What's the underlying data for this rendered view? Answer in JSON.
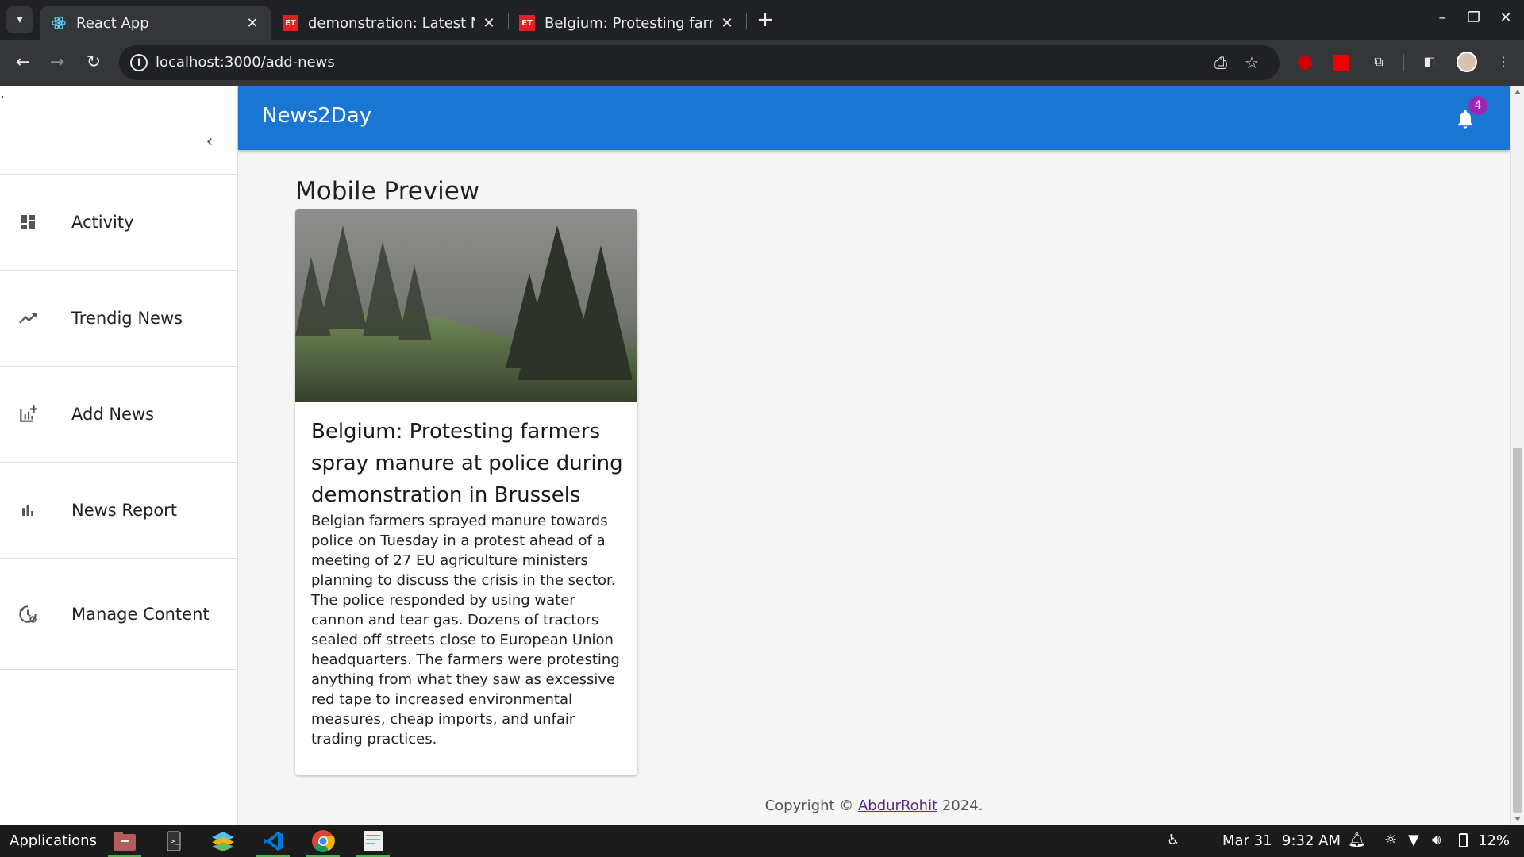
{
  "browser": {
    "tabs": [
      {
        "title": "React App",
        "active": true
      },
      {
        "title": "demonstration: Latest N",
        "active": false
      },
      {
        "title": "Belgium: Protesting farm",
        "active": false
      }
    ],
    "tab_favicon_text": "ET",
    "url": "localhost:3000/add-news"
  },
  "sidebar": {
    "items": [
      {
        "label": "Activity",
        "icon": "dashboard-icon"
      },
      {
        "label": "Trendig News",
        "icon": "trending-up-icon"
      },
      {
        "label": "Add News",
        "icon": "add-chart-icon"
      },
      {
        "label": "News Report",
        "icon": "bar-chart-icon"
      },
      {
        "label": "Manage Content",
        "icon": "manage-history-icon"
      }
    ]
  },
  "appbar": {
    "title": "News2Day",
    "notification_count": "4",
    "color": "#1976d2",
    "badge_color": "#9c27b0"
  },
  "main": {
    "section_title": "Mobile Preview",
    "card": {
      "headline": "Belgium: Protesting farmers spray manure at police during demonstration in Brussels",
      "body": "Belgian farmers sprayed manure towards police on Tuesday in a protest ahead of a meeting of 27 EU agriculture ministers planning to discuss the crisis in the sector. The police responded by using water cannon and tear gas. Dozens of tractors sealed off streets close to European Union headquarters. The farmers were protesting anything from what they saw as excessive red tape to increased environmental measures, cheap imports, and unfair trading practices."
    }
  },
  "footer": {
    "prefix": "Copyright © ",
    "link": "AbdurRohit",
    "suffix": " 2024."
  },
  "taskbar": {
    "applications_label": "Applications",
    "date": "Mar 31",
    "time": "9:32 AM",
    "battery": "12%"
  }
}
